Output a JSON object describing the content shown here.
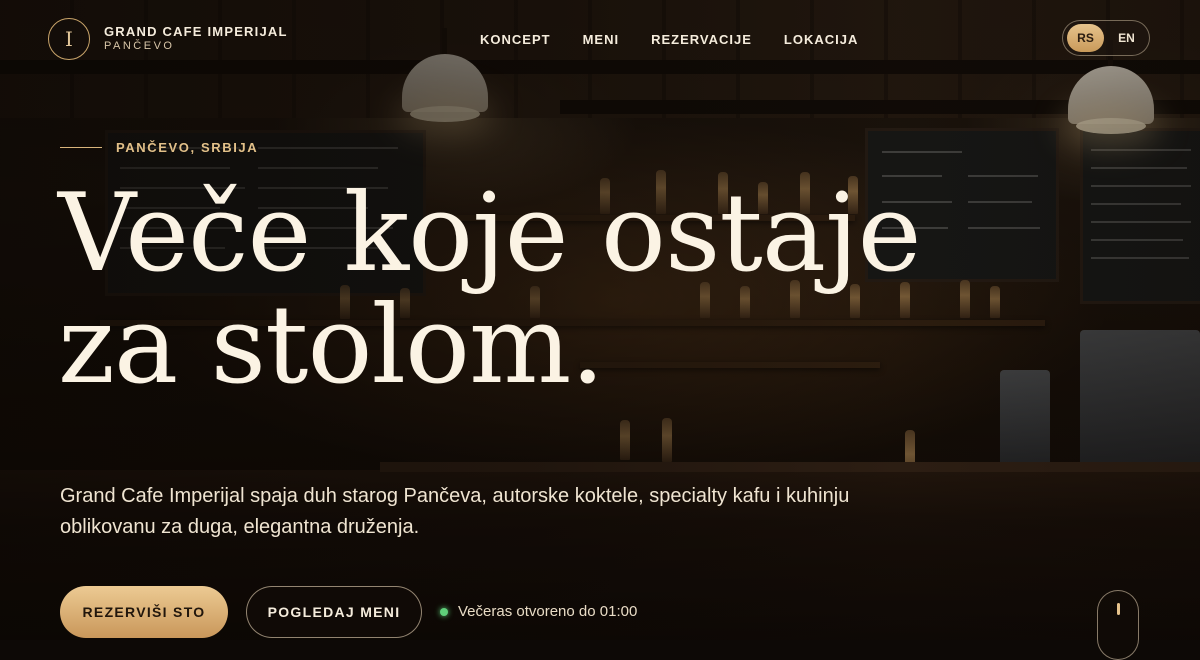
{
  "brand": {
    "logo_letter": "I",
    "name": "GRAND CAFE IMPERIJAL",
    "city": "PANČEVO"
  },
  "nav": {
    "items": [
      {
        "label": "KONCEPT"
      },
      {
        "label": "MENI"
      },
      {
        "label": "REZERVACIJE"
      },
      {
        "label": "LOKACIJA"
      }
    ]
  },
  "language": {
    "options": [
      "RS",
      "EN"
    ],
    "active": "RS"
  },
  "hero": {
    "eyebrow": "PANČEVO, SRBIJA",
    "headline_line1": "Veče koje ostaje",
    "headline_line2": "za stolom.",
    "lead": "Grand Cafe Imperijal spaja duh starog Pančeva, autorske koktele, specialty kafu i kuhinju oblikovanu za duga, elegantna druženja.",
    "primary_cta": "REZERVIŠI STO",
    "secondary_cta": "POGLEDAJ MENI",
    "status_text": "Večeras otvoreno do 01:00"
  },
  "colors": {
    "accent_gold": "#e2c089",
    "button_gold": "#d4a86e",
    "status_green": "#5fd07a",
    "text_cream": "#fbf3e4"
  },
  "icons": {
    "status": "open-status-dot-icon",
    "scroll": "scroll-down-icon"
  }
}
